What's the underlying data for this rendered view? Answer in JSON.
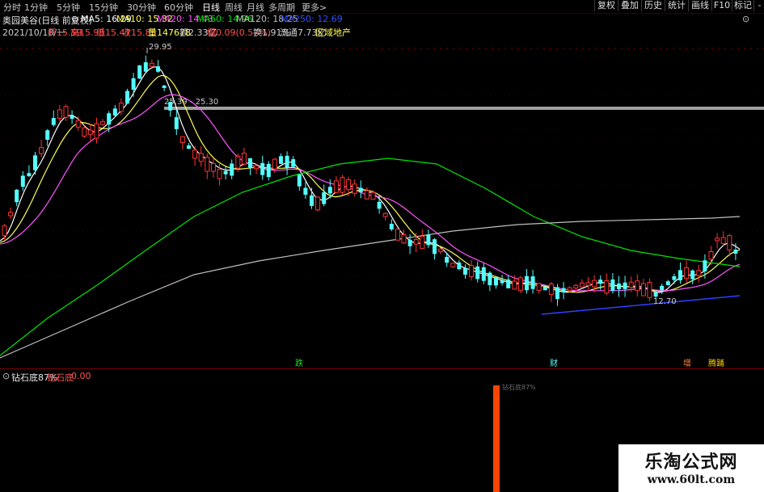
{
  "toolbar": {
    "periods": [
      "分时",
      "1分钟",
      "5分钟",
      "15分钟",
      "30分钟",
      "60分钟",
      "日线",
      "周线",
      "月线",
      "多周期",
      "更多>"
    ],
    "active_period": "日线",
    "right_buttons": [
      "复权",
      "叠加",
      "历史",
      "统计",
      "画线",
      "F10",
      "标记",
      "-"
    ]
  },
  "info": {
    "stock_name": "奥园美谷(日线 前复权)",
    "ma5": "MA5: 16.29",
    "ma10": "MA10: 15.32",
    "ma20": "MA20: 14.43",
    "ma60": "MA60: 14.96",
    "ma120": "MA120: 18.25",
    "ma250": "MA250: 12.69",
    "date": "2021/10/18/一",
    "open": "开15.59",
    "high": "高15.98",
    "low": "低15.47",
    "close": "收15.85",
    "volume": "量147678",
    "amount": "额2.33亿",
    "change": "幅0.09(0.57%)",
    "turnover": "换1.91%",
    "float_cap": "流通7.73亿",
    "sector": "区域地产"
  },
  "annotations": {
    "high_label": "29.95",
    "price_range": "25.39 - 25.30",
    "low_label": "12.70"
  },
  "markers": [
    "跌",
    "财",
    "增",
    "腾踊"
  ],
  "indicator": {
    "name": "钻石底87%",
    "label": "钻石底",
    "value": "0.00",
    "bar_caption": "钻石底87%"
  },
  "watermark": {
    "title": "乐淘公式网",
    "url": "www.60lt.com"
  },
  "colors": {
    "up": "#ff3232",
    "down": "#54ffff",
    "ma5": "#ffffff",
    "ma10": "#ffff55",
    "ma20": "#ff55ff",
    "ma60": "#00e600",
    "ma120": "#c0c0c0",
    "ma250": "#3050ff",
    "indicator_bar": "#ff4400"
  }
}
